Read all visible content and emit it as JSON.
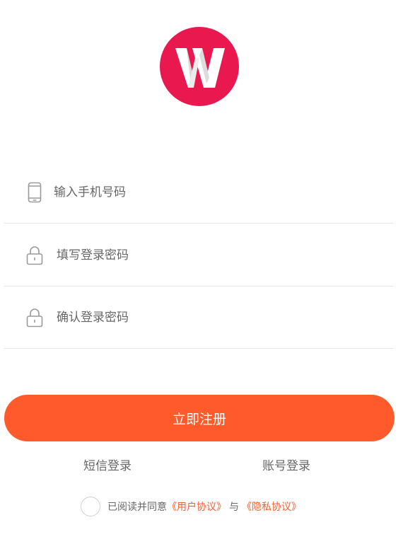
{
  "colors": {
    "brand": "#e9184f",
    "accent": "#ff5a2b",
    "link": "#ff5a2b",
    "divider": "#e4e4e4"
  },
  "logo": {
    "letter": "W",
    "icon": "brand-logo-w"
  },
  "form": {
    "phone": {
      "placeholder": "输入手机号码",
      "icon": "phone-icon"
    },
    "password": {
      "placeholder": "填写登录密码",
      "icon": "lock-icon"
    },
    "confirm": {
      "placeholder": "确认登录密码",
      "icon": "lock-icon"
    }
  },
  "actions": {
    "register_label": "立即注册",
    "sms_login_label": "短信登录",
    "account_login_label": "账号登录"
  },
  "agreement": {
    "prefix": "已阅读并同意",
    "user_agreement": "《用户协议》",
    "joiner": "与",
    "privacy_policy": "《隐私协议》",
    "checked": false
  }
}
